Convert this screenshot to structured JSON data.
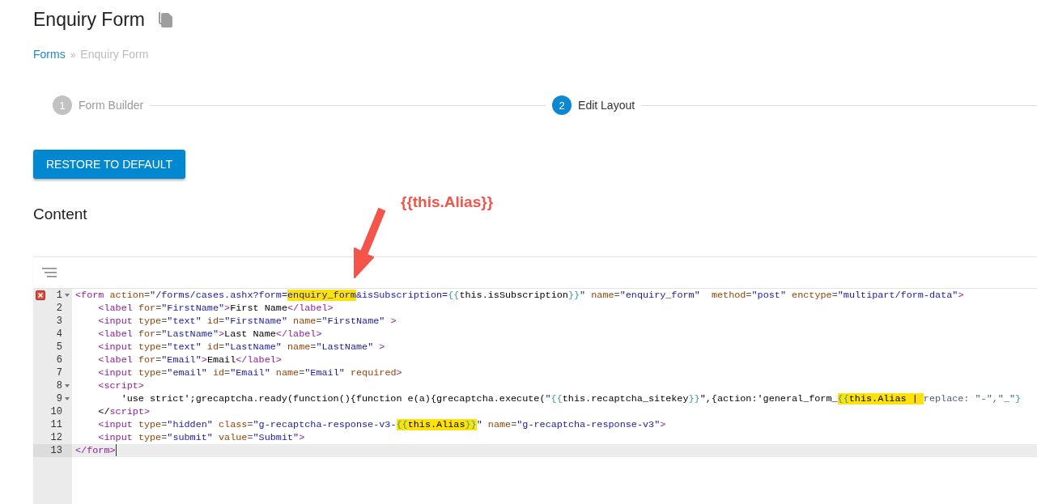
{
  "page": {
    "title": "Enquiry Form"
  },
  "breadcrumb": {
    "items": [
      {
        "label": "Forms",
        "link": true
      },
      {
        "label": "Enquiry Form",
        "link": false
      }
    ],
    "separator": "»"
  },
  "stepper": [
    {
      "number": "1",
      "label": "Form Builder",
      "active": false
    },
    {
      "number": "2",
      "label": "Edit Layout",
      "active": true
    }
  ],
  "restore_button": "RESTORE TO DEFAULT",
  "section_title": "Content",
  "annotation": {
    "text": "{{this.Alias}}"
  },
  "editor": {
    "lines": [
      {
        "number": "1",
        "error": true,
        "foldable": true,
        "current": false,
        "tokens": [
          {
            "kind": "tag",
            "text": "<form"
          },
          {
            "kind": "attr",
            "text": " action"
          },
          {
            "kind": "eq",
            "text": "="
          },
          {
            "kind": "str",
            "text": "\"/forms/cases.ashx?form="
          },
          {
            "kind": "mark",
            "children": [
              {
                "kind": "str",
                "text": "enquiry_form"
              }
            ]
          },
          {
            "kind": "str",
            "text": "&isSubscription="
          },
          {
            "kind": "brace",
            "text": "{{"
          },
          {
            "kind": "text",
            "text": "this.isSubscription"
          },
          {
            "kind": "brace",
            "text": "}}"
          },
          {
            "kind": "str",
            "text": "\""
          },
          {
            "kind": "attr",
            "text": " name"
          },
          {
            "kind": "eq",
            "text": "="
          },
          {
            "kind": "str",
            "text": "\"enquiry_form\""
          },
          {
            "kind": "attr",
            "text": "  method"
          },
          {
            "kind": "eq",
            "text": "="
          },
          {
            "kind": "str",
            "text": "\"post\""
          },
          {
            "kind": "attr",
            "text": " enctype"
          },
          {
            "kind": "eq",
            "text": "="
          },
          {
            "kind": "str",
            "text": "\"multipart/form-data\""
          },
          {
            "kind": "tag",
            "text": ">"
          }
        ]
      },
      {
        "number": "2",
        "error": false,
        "foldable": false,
        "current": false,
        "tokens": [
          {
            "kind": "tag",
            "text": "    <label"
          },
          {
            "kind": "attr",
            "text": " for"
          },
          {
            "kind": "eq",
            "text": "="
          },
          {
            "kind": "str",
            "text": "\"FirstName\""
          },
          {
            "kind": "tag",
            "text": ">"
          },
          {
            "kind": "text",
            "text": "First Name"
          },
          {
            "kind": "tag",
            "text": "</label>"
          }
        ]
      },
      {
        "number": "3",
        "error": false,
        "foldable": false,
        "current": false,
        "tokens": [
          {
            "kind": "tag",
            "text": "    <input"
          },
          {
            "kind": "attr",
            "text": " type"
          },
          {
            "kind": "eq",
            "text": "="
          },
          {
            "kind": "str",
            "text": "\"text\""
          },
          {
            "kind": "attr",
            "text": " id"
          },
          {
            "kind": "eq",
            "text": "="
          },
          {
            "kind": "str",
            "text": "\"FirstName\""
          },
          {
            "kind": "attr",
            "text": " name"
          },
          {
            "kind": "eq",
            "text": "="
          },
          {
            "kind": "str",
            "text": "\"FirstName\""
          },
          {
            "kind": "tag",
            "text": " >"
          }
        ]
      },
      {
        "number": "4",
        "error": false,
        "foldable": false,
        "current": false,
        "tokens": [
          {
            "kind": "tag",
            "text": "    <label"
          },
          {
            "kind": "attr",
            "text": " for"
          },
          {
            "kind": "eq",
            "text": "="
          },
          {
            "kind": "str",
            "text": "\"LastName\""
          },
          {
            "kind": "tag",
            "text": ">"
          },
          {
            "kind": "text",
            "text": "Last Name"
          },
          {
            "kind": "tag",
            "text": "</label>"
          }
        ]
      },
      {
        "number": "5",
        "error": false,
        "foldable": false,
        "current": false,
        "tokens": [
          {
            "kind": "tag",
            "text": "    <input"
          },
          {
            "kind": "attr",
            "text": " type"
          },
          {
            "kind": "eq",
            "text": "="
          },
          {
            "kind": "str",
            "text": "\"text\""
          },
          {
            "kind": "attr",
            "text": " id"
          },
          {
            "kind": "eq",
            "text": "="
          },
          {
            "kind": "str",
            "text": "\"LastName\""
          },
          {
            "kind": "attr",
            "text": " name"
          },
          {
            "kind": "eq",
            "text": "="
          },
          {
            "kind": "str",
            "text": "\"LastName\""
          },
          {
            "kind": "tag",
            "text": " >"
          }
        ]
      },
      {
        "number": "6",
        "error": false,
        "foldable": false,
        "current": false,
        "tokens": [
          {
            "kind": "tag",
            "text": "    <label"
          },
          {
            "kind": "attr",
            "text": " for"
          },
          {
            "kind": "eq",
            "text": "="
          },
          {
            "kind": "str",
            "text": "\"Email\""
          },
          {
            "kind": "tag",
            "text": ">"
          },
          {
            "kind": "text",
            "text": "Email"
          },
          {
            "kind": "tag",
            "text": "</label>"
          }
        ]
      },
      {
        "number": "7",
        "error": false,
        "foldable": false,
        "current": false,
        "tokens": [
          {
            "kind": "tag",
            "text": "    <input"
          },
          {
            "kind": "attr",
            "text": " type"
          },
          {
            "kind": "eq",
            "text": "="
          },
          {
            "kind": "str",
            "text": "\"email\""
          },
          {
            "kind": "attr",
            "text": " id"
          },
          {
            "kind": "eq",
            "text": "="
          },
          {
            "kind": "str",
            "text": "\"Email\""
          },
          {
            "kind": "attr",
            "text": " name"
          },
          {
            "kind": "eq",
            "text": "="
          },
          {
            "kind": "str",
            "text": "\"Email\""
          },
          {
            "kind": "attr",
            "text": " required"
          },
          {
            "kind": "tag",
            "text": ">"
          }
        ]
      },
      {
        "number": "8",
        "error": false,
        "foldable": true,
        "current": false,
        "tokens": [
          {
            "kind": "tag",
            "text": "    <script>"
          }
        ]
      },
      {
        "number": "9",
        "error": false,
        "foldable": true,
        "current": false,
        "tokens": [
          {
            "kind": "text",
            "text": "        'use strict';grecaptcha.ready(function(){function e(a){grecaptcha.execute("
          },
          {
            "kind": "str",
            "text": "\""
          },
          {
            "kind": "brace",
            "text": "{{"
          },
          {
            "kind": "text",
            "text": "this.recaptcha_sitekey"
          },
          {
            "kind": "brace",
            "text": "}}"
          },
          {
            "kind": "text",
            "text": "\",{action:'general_form_"
          },
          {
            "kind": "mark",
            "children": [
              {
                "kind": "brace",
                "text": "{{"
              },
              {
                "kind": "text",
                "text": "this.Alias | "
              }
            ]
          },
          {
            "kind": "filter",
            "text": "replace: \"-\",\"_\""
          },
          {
            "kind": "brace",
            "text": "}"
          }
        ]
      },
      {
        "number": "10",
        "error": false,
        "foldable": false,
        "current": false,
        "tokens": [
          {
            "kind": "text",
            "text": "    </"
          },
          {
            "kind": "tag",
            "text": "script>"
          }
        ]
      },
      {
        "number": "11",
        "error": false,
        "foldable": false,
        "current": false,
        "tokens": [
          {
            "kind": "tag",
            "text": "    <input"
          },
          {
            "kind": "attr",
            "text": " type"
          },
          {
            "kind": "eq",
            "text": "="
          },
          {
            "kind": "str",
            "text": "\"hidden\""
          },
          {
            "kind": "attr",
            "text": " class"
          },
          {
            "kind": "eq",
            "text": "="
          },
          {
            "kind": "str",
            "text": "\"g-recaptcha-response-v3-"
          },
          {
            "kind": "mark",
            "children": [
              {
                "kind": "brace",
                "text": "{{"
              },
              {
                "kind": "text",
                "text": "this.Alias"
              },
              {
                "kind": "brace",
                "text": "}}"
              }
            ]
          },
          {
            "kind": "str",
            "text": "\""
          },
          {
            "kind": "attr",
            "text": " name"
          },
          {
            "kind": "eq",
            "text": "="
          },
          {
            "kind": "str",
            "text": "\"g-recaptcha-response-v3\""
          },
          {
            "kind": "tag",
            "text": ">"
          }
        ]
      },
      {
        "number": "12",
        "error": false,
        "foldable": false,
        "current": false,
        "tokens": [
          {
            "kind": "tag",
            "text": "    <input"
          },
          {
            "kind": "attr",
            "text": " type"
          },
          {
            "kind": "eq",
            "text": "="
          },
          {
            "kind": "str",
            "text": "\"submit\""
          },
          {
            "kind": "attr",
            "text": " value"
          },
          {
            "kind": "eq",
            "text": "="
          },
          {
            "kind": "str",
            "text": "\"Submit\""
          },
          {
            "kind": "tag",
            "text": ">"
          }
        ]
      },
      {
        "number": "13",
        "error": false,
        "foldable": false,
        "current": true,
        "tokens": [
          {
            "kind": "tag",
            "text": "</form>"
          }
        ]
      }
    ]
  }
}
